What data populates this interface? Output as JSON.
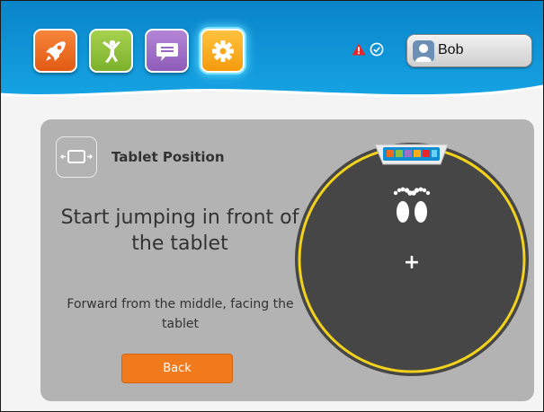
{
  "header": {
    "apps": [
      {
        "name": "rocket",
        "color": "#ee6a1f",
        "active": false
      },
      {
        "name": "fitness",
        "color": "#8fc13c",
        "active": false
      },
      {
        "name": "chat",
        "color": "#a070c4",
        "active": false
      },
      {
        "name": "settings",
        "color": "#ffae1a",
        "active": true
      }
    ],
    "status": {
      "warning_color": "#e8262a",
      "ok_color": "#ffffff"
    },
    "user": {
      "name": "Bob"
    }
  },
  "panel": {
    "section_title": "Tablet Position",
    "headline": "Start jumping in front of the tablet",
    "instruction": "Forward from the middle, facing the tablet",
    "back_label": "Back",
    "center_mark": "+"
  },
  "colors": {
    "header_blue": "#0e8fd4",
    "trampoline": "#464646",
    "ring": "#f2d21c",
    "accent": "#f07a1c"
  }
}
